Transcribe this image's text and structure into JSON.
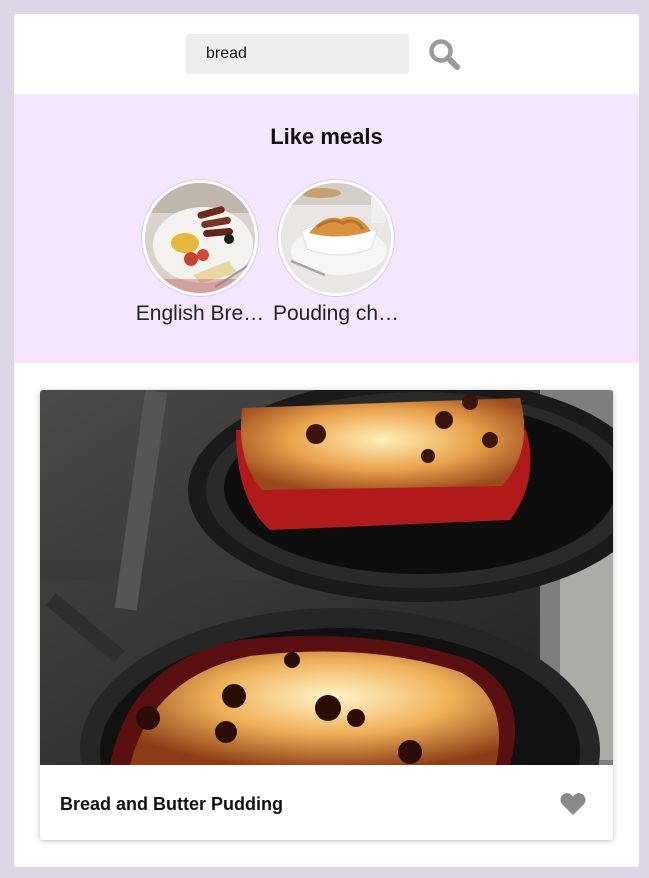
{
  "search": {
    "value": "bread",
    "icon": "search-icon"
  },
  "like_meals": {
    "title": "Like meals",
    "items": [
      {
        "label": "English Bre…",
        "thumb": "full-breakfast-photo"
      },
      {
        "label": "Pouding ch…",
        "thumb": "pudding-photo"
      }
    ]
  },
  "meal": {
    "title": "Bread and Butter Pudding",
    "photo": "bread-pudding-photo",
    "favorite_icon": "heart-icon"
  },
  "colors": {
    "background": "#ddd6e9",
    "like_section_bg": "#f4e6fc",
    "search_input_bg": "#eeeeee",
    "icon_gray": "#8a8a8a"
  }
}
